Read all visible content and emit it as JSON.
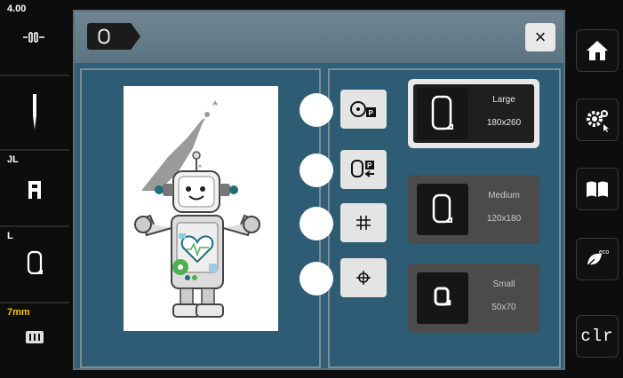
{
  "status": {
    "stitch_width_value": "4.00",
    "foot_label": "JL",
    "hoop_label": "L",
    "stitch_length_value": "7mm"
  },
  "header": {
    "close_label": "×"
  },
  "hoops": [
    {
      "name": "Large",
      "size": "180x260",
      "selected": true
    },
    {
      "name": "Medium",
      "size": "120x180",
      "selected": false
    },
    {
      "name": "Small",
      "size": "50x70",
      "selected": false
    }
  ],
  "right_bar": {
    "clr_label": "clr"
  },
  "colors": {
    "panel_bg": "#2e5c74",
    "accent_yellow": "#f2c400",
    "design_green": "#4caf50",
    "design_teal": "#1e6f79"
  },
  "icons": [
    "home-icon",
    "settings-icon",
    "tutorial-book-icon",
    "eco-icon",
    "needle-icon",
    "presser-foot-icon",
    "hoop-icon",
    "feed-dog-icon"
  ]
}
